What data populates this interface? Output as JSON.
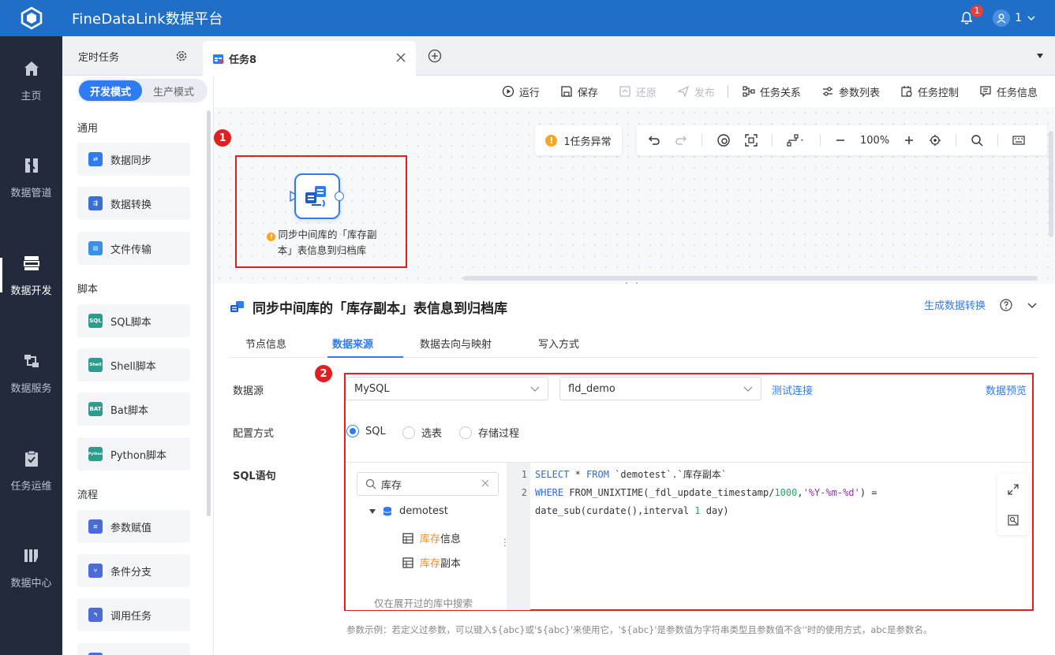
{
  "app": {
    "title": "FineDataLink数据平台"
  },
  "header": {
    "notification_count": "1",
    "user_name": "1"
  },
  "leftnav": {
    "items": [
      {
        "label": "主页"
      },
      {
        "label": "数据管道"
      },
      {
        "label": "数据开发"
      },
      {
        "label": "数据服务"
      },
      {
        "label": "任务运维"
      },
      {
        "label": "数据中心"
      }
    ],
    "active": "数据开发"
  },
  "tabs": {
    "scheduled": "定时任务",
    "current": "任务8"
  },
  "mode": {
    "dev": "开发模式",
    "prod": "生产模式"
  },
  "palette": {
    "sections": {
      "general": "通用",
      "script": "脚本",
      "flow": "流程"
    },
    "general_items": [
      "数据同步",
      "数据转换",
      "文件传输"
    ],
    "script_items": [
      "SQL脚本",
      "Shell脚本",
      "Bat脚本",
      "Python脚本"
    ],
    "script_icon_text": [
      "SQL",
      "Shell",
      "BAT",
      "Python"
    ],
    "flow_items": [
      "参数赋值",
      "条件分支",
      "调用任务"
    ]
  },
  "toolbar": {
    "run": "运行",
    "save": "保存",
    "restore": "还原",
    "publish": "发布",
    "relations": "任务关系",
    "params": "参数列表",
    "control": "任务控制",
    "info": "任务信息"
  },
  "canvas": {
    "warning": "1任务异常",
    "zoom": "100%",
    "badge1": "1",
    "node_label_line1": "同步中间库的「库存副",
    "node_label_line2": "本」表信息到归档库",
    "warn_mark": "!"
  },
  "detail": {
    "title": "同步中间库的「库存副本」表信息到归档库",
    "generate_link": "生成数据转换",
    "tabs": [
      "节点信息",
      "数据来源",
      "数据去向与映射",
      "写入方式"
    ],
    "active_tab": "数据来源",
    "badge2": "2",
    "labels": {
      "datasource": "数据源",
      "config": "配置方式",
      "sql": "SQL语句"
    },
    "datasource_type": "MySQL",
    "datasource_conn": "fld_demo",
    "test_link": "测试连接",
    "preview_link": "数据预览",
    "config_options": [
      "SQL",
      "选表",
      "存储过程"
    ],
    "config_selected": "SQL",
    "search_value": "库存",
    "tree": {
      "db": "demotest",
      "tables": [
        {
          "match": "库存",
          "rest": "信息"
        },
        {
          "match": "库存",
          "rest": "副本"
        }
      ],
      "footer": "仅在展开过的库中搜索"
    },
    "code_lines": [
      "1",
      "2"
    ],
    "hint": "参数示例：若定义过参数，可以键入${abc}或'${abc}'来使用它，'${abc}'是参数值为字符串类型且参数值不含''时的使用方式，abc是参数名。"
  },
  "colors": {
    "brand": "#1f6fc9",
    "accent": "#2f7bf1",
    "highlight": "#e02020",
    "nav_bg": "#232a3b"
  }
}
